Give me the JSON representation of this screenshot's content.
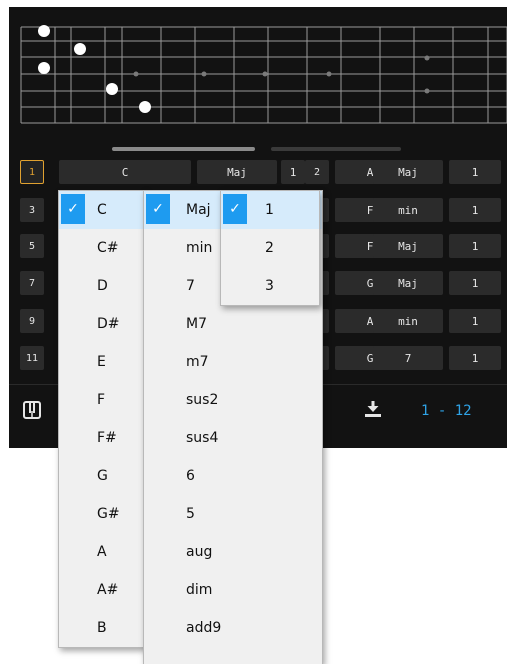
{
  "table": {
    "rows": [
      [
        "1",
        "C",
        "Maj",
        "1",
        "2",
        "A",
        "Maj",
        "1"
      ],
      [
        "3",
        "",
        "",
        "",
        "",
        "F",
        "min",
        "1"
      ],
      [
        "5",
        "",
        "",
        "",
        "",
        "F",
        "Maj",
        "1"
      ],
      [
        "7",
        "",
        "",
        "",
        "",
        "G",
        "Maj",
        "1"
      ],
      [
        "9",
        "",
        "",
        "",
        "",
        "A",
        "min",
        "1"
      ],
      [
        "11",
        "",
        "",
        "",
        "",
        "G",
        "7",
        "1"
      ]
    ]
  },
  "toolbar": {
    "page_range": "1 - 12"
  },
  "root_menu": {
    "items": [
      "C",
      "C#",
      "D",
      "D#",
      "E",
      "F",
      "F#",
      "G",
      "G#",
      "A",
      "A#",
      "B"
    ],
    "checked_index": 0
  },
  "quality_menu": {
    "items": [
      "Maj",
      "min",
      "7",
      "M7",
      "m7",
      "sus2",
      "sus4",
      "6",
      "5",
      "aug",
      "dim",
      "add9"
    ],
    "checked_index": 0
  },
  "voicing_menu": {
    "items": [
      "1",
      "2",
      "3"
    ],
    "checked_index": 0
  },
  "icons": {
    "piano": "piano-icon",
    "download": "download-icon",
    "check": "check-icon"
  },
  "colors": {
    "background": "#121212",
    "cell": "#2b2b2b",
    "selected_border": "#e0a130",
    "accent": "#1e9bf0",
    "page_range": "#2fa3e6"
  }
}
